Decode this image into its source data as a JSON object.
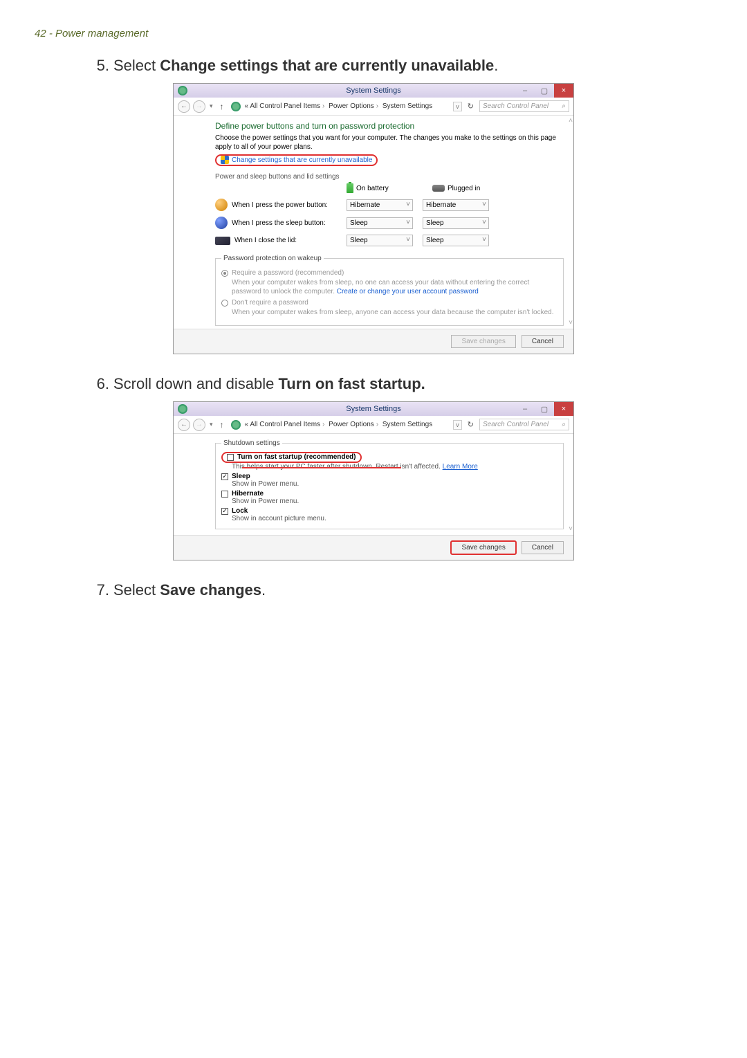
{
  "page_header": "42 - Power management",
  "steps": {
    "s5": {
      "num": "5.",
      "pre": "Select ",
      "bold": "Change settings that are currently unavailable",
      "post": "."
    },
    "s6": {
      "num": "6.",
      "pre": "Scroll down and disable ",
      "bold": "Turn on fast startup.",
      "post": ""
    },
    "s7": {
      "num": "7.",
      "pre": "Select ",
      "bold": "Save changes",
      "post": "."
    }
  },
  "win_common": {
    "title": "System Settings",
    "minimize": "–",
    "maximize": "▢",
    "close": "×",
    "back": "←",
    "fwd": "→",
    "chev": "▾",
    "up": "↑",
    "crumb_lead": "«",
    "crumb1": "All Control Panel Items",
    "crumb2": "Power Options",
    "crumb3": "System Settings",
    "sep": "›",
    "addr_dd": "v",
    "refresh": "↻",
    "search_placeholder": "Search Control Panel",
    "scroll_up": "˄",
    "scroll_dn": "˅"
  },
  "shot1": {
    "heading": "Define power buttons and turn on password protection",
    "intro": "Choose the power settings that you want for your computer. The changes you make to the settings on this page apply to all of your power plans.",
    "change_link": "Change settings that are currently unavailable",
    "subheading": "Power and sleep buttons and lid settings",
    "col_batt": "On battery",
    "col_plug": "Plugged in",
    "rows": {
      "power": {
        "label": "When I press the power button:",
        "batt": "Hibernate",
        "plug": "Hibernate"
      },
      "sleep": {
        "label": "When I press the sleep button:",
        "batt": "Sleep",
        "plug": "Sleep"
      },
      "lid": {
        "label": "When I close the lid:",
        "batt": "Sleep",
        "plug": "Sleep"
      }
    },
    "pwd_legend": "Password protection on wakeup",
    "req_label": "Require a password (recommended)",
    "req_desc_a": "When your computer wakes from sleep, no one can access your data without entering the correct password to unlock the computer. ",
    "req_desc_link": "Create or change your user account password",
    "noreq_label": "Don't require a password",
    "noreq_desc": "When your computer wakes from sleep, anyone can access your data because the computer isn't locked.",
    "save": "Save changes",
    "cancel": "Cancel"
  },
  "shot2": {
    "legend": "Shutdown settings",
    "fast_label": "Turn on fast startup (recommended)",
    "fast_desc_a": "This helps start your PC faster after shutdown. Restart isn't affected. ",
    "fast_desc_link": "Learn More",
    "sleep_label": "Sleep",
    "sleep_desc": "Show in Power menu.",
    "hib_label": "Hibernate",
    "hib_desc": "Show in Power menu.",
    "lock_label": "Lock",
    "lock_desc": "Show in account picture menu.",
    "save": "Save changes",
    "cancel": "Cancel"
  }
}
